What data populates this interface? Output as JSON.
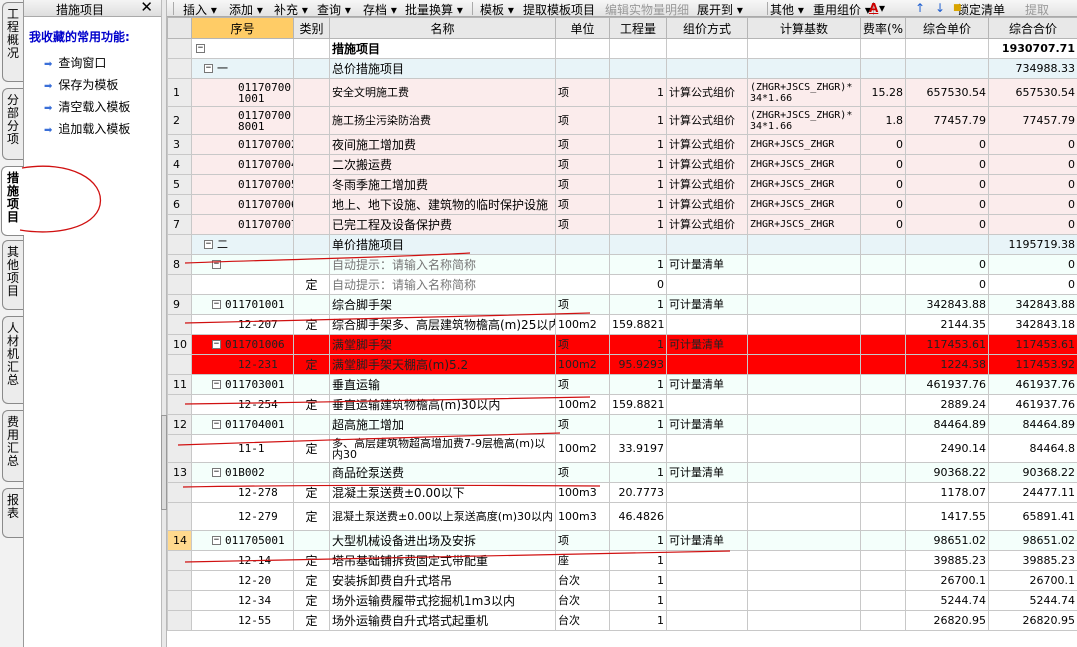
{
  "left_tabs": [
    {
      "label": "工程概况",
      "active": false
    },
    {
      "label": "分部分项",
      "active": false
    },
    {
      "label": "措施项目",
      "active": true
    },
    {
      "label": "其他项目",
      "active": false
    },
    {
      "label": "人材机汇总",
      "active": false
    },
    {
      "label": "费用汇总",
      "active": false
    },
    {
      "label": "报表",
      "active": false
    }
  ],
  "panel": {
    "title": "措施项目",
    "close_icon": "✕",
    "favorites_title": "我收藏的常用功能:",
    "items": [
      "查询窗口",
      "保存为模板",
      "清空载入模板",
      "追加载入模板"
    ]
  },
  "toolbar": {
    "items": [
      "插入 ▾",
      "添加 ▾",
      "补充 ▾",
      "查询 ▾",
      "存档 ▾",
      "批量换算 ▾",
      "模板 ▾",
      "提取模板项目",
      "编辑实物量明细",
      "展开到 ▾",
      "其他 ▾",
      "重用组价 ▾",
      "▾",
      "↑",
      "↓",
      "锁定清单",
      "提取"
    ]
  },
  "columns": [
    "序号",
    "类别",
    "名称",
    "单位",
    "工程量",
    "组价方式",
    "计算基数",
    "费率(%",
    "综合单价",
    "综合合价"
  ],
  "rows": [
    {
      "seq": "",
      "code": "",
      "cat": "",
      "name": "措施项目",
      "unit": "",
      "qty": "",
      "method": "",
      "base": "",
      "rate": "",
      "price": "",
      "total": "1930707.71",
      "style": "total",
      "tree": "−"
    },
    {
      "seq": "",
      "code": "一",
      "cat": "",
      "name": "总价措施项目",
      "unit": "",
      "qty": "",
      "method": "",
      "base": "",
      "rate": "",
      "price": "",
      "total": "734988.33",
      "style": "sec",
      "tree": "−"
    },
    {
      "seq": "1",
      "code": "011707001001",
      "cat": "",
      "name": "安全文明施工费",
      "unit": "项",
      "qty": "1",
      "method": "计算公式组价",
      "base": "(ZHGR+JSCS_ZHGR)*34*1.66",
      "rate": "15.28",
      "price": "657530.54",
      "total": "657530.54",
      "style": "pink",
      "tall": true
    },
    {
      "seq": "2",
      "code": "011707008001",
      "cat": "",
      "name": "施工扬尘污染防治费",
      "unit": "项",
      "qty": "1",
      "method": "计算公式组价",
      "base": "(ZHGR+JSCS_ZHGR)*34*1.66",
      "rate": "1.8",
      "price": "77457.79",
      "total": "77457.79",
      "style": "pink",
      "tall": true
    },
    {
      "seq": "3",
      "code": "011707002",
      "cat": "",
      "name": "夜间施工增加费",
      "unit": "项",
      "qty": "1",
      "method": "计算公式组价",
      "base": "ZHGR+JSCS_ZHGR",
      "rate": "0",
      "price": "0",
      "total": "0",
      "style": "pink"
    },
    {
      "seq": "4",
      "code": "011707004",
      "cat": "",
      "name": "二次搬运费",
      "unit": "项",
      "qty": "1",
      "method": "计算公式组价",
      "base": "ZHGR+JSCS_ZHGR",
      "rate": "0",
      "price": "0",
      "total": "0",
      "style": "pink"
    },
    {
      "seq": "5",
      "code": "011707005",
      "cat": "",
      "name": "冬雨季施工增加费",
      "unit": "项",
      "qty": "1",
      "method": "计算公式组价",
      "base": "ZHGR+JSCS_ZHGR",
      "rate": "0",
      "price": "0",
      "total": "0",
      "style": "pink"
    },
    {
      "seq": "6",
      "code": "011707006",
      "cat": "",
      "name": "地上、地下设施、建筑物的临时保护设施",
      "unit": "项",
      "qty": "1",
      "method": "计算公式组价",
      "base": "ZHGR+JSCS_ZHGR",
      "rate": "0",
      "price": "0",
      "total": "0",
      "style": "pink"
    },
    {
      "seq": "7",
      "code": "011707007",
      "cat": "",
      "name": "已完工程及设备保护费",
      "unit": "项",
      "qty": "1",
      "method": "计算公式组价",
      "base": "ZHGR+JSCS_ZHGR",
      "rate": "0",
      "price": "0",
      "total": "0",
      "style": "pink"
    },
    {
      "seq": "",
      "code": "二",
      "cat": "",
      "name": "单价措施项目",
      "unit": "",
      "qty": "",
      "method": "",
      "base": "",
      "rate": "",
      "price": "",
      "total": "1195719.38",
      "style": "sec",
      "tree": "−"
    },
    {
      "seq": "8",
      "code": "",
      "cat": "",
      "name": "自动提示：请输入名称简称",
      "unit": "",
      "qty": "1",
      "method": "可计量清单",
      "base": "",
      "rate": "",
      "price": "0",
      "total": "0",
      "style": "sub",
      "tree": "−",
      "grey": true
    },
    {
      "seq": "",
      "code": "",
      "cat": "定",
      "name": "自动提示：请输入名称简称",
      "unit": "",
      "qty": "0",
      "method": "",
      "base": "",
      "rate": "",
      "price": "0",
      "total": "0",
      "style": "white",
      "grey": true
    },
    {
      "seq": "9",
      "code": "011701001",
      "cat": "",
      "name": "综合脚手架",
      "unit": "项",
      "qty": "1",
      "method": "可计量清单",
      "base": "",
      "rate": "",
      "price": "342843.88",
      "total": "342843.88",
      "style": "sub",
      "tree": "−"
    },
    {
      "seq": "",
      "code": "12-207",
      "cat": "定",
      "name": "综合脚手架多、高层建筑物檐高(m)25以内",
      "unit": "100m2",
      "qty": "159.8821",
      "method": "",
      "base": "",
      "rate": "",
      "price": "2144.35",
      "total": "342843.18",
      "style": "white"
    },
    {
      "seq": "10",
      "code": "011701006",
      "cat": "",
      "name": "满堂脚手架",
      "unit": "项",
      "qty": "1",
      "method": "可计量清单",
      "base": "",
      "rate": "",
      "price": "117453.61",
      "total": "117453.61",
      "style": "red",
      "tree": "−"
    },
    {
      "seq": "",
      "code": "12-231",
      "cat": "定",
      "name": "满堂脚手架天棚高(m)5.2",
      "unit": "100m2",
      "qty": "95.9293",
      "method": "",
      "base": "",
      "rate": "",
      "price": "1224.38",
      "total": "117453.92",
      "style": "red"
    },
    {
      "seq": "11",
      "code": "011703001",
      "cat": "",
      "name": "垂直运输",
      "unit": "项",
      "qty": "1",
      "method": "可计量清单",
      "base": "",
      "rate": "",
      "price": "461937.76",
      "total": "461937.76",
      "style": "sub",
      "tree": "−"
    },
    {
      "seq": "",
      "code": "12-254",
      "cat": "定",
      "name": "垂直运输建筑物檐高(m)30以内",
      "unit": "100m2",
      "qty": "159.8821",
      "method": "",
      "base": "",
      "rate": "",
      "price": "2889.24",
      "total": "461937.76",
      "style": "white"
    },
    {
      "seq": "12",
      "code": "011704001",
      "cat": "",
      "name": "超高施工增加",
      "unit": "项",
      "qty": "1",
      "method": "可计量清单",
      "base": "",
      "rate": "",
      "price": "84464.89",
      "total": "84464.89",
      "style": "sub",
      "tree": "−"
    },
    {
      "seq": "",
      "code": "11-1",
      "cat": "定",
      "name": "多、高层建筑物超高增加费7-9层檐高(m)以内30",
      "unit": "100m2",
      "qty": "33.9197",
      "method": "",
      "base": "",
      "rate": "",
      "price": "2490.14",
      "total": "84464.8",
      "style": "white",
      "tall": true
    },
    {
      "seq": "13",
      "code": "01B002",
      "cat": "",
      "name": "商品砼泵送费",
      "unit": "项",
      "qty": "1",
      "method": "可计量清单",
      "base": "",
      "rate": "",
      "price": "90368.22",
      "total": "90368.22",
      "style": "sub",
      "tree": "−"
    },
    {
      "seq": "",
      "code": "12-278",
      "cat": "定",
      "name": "混凝土泵送费±0.00以下",
      "unit": "100m3",
      "qty": "20.7773",
      "method": "",
      "base": "",
      "rate": "",
      "price": "1178.07",
      "total": "24477.11",
      "style": "white"
    },
    {
      "seq": "",
      "code": "12-279",
      "cat": "定",
      "name": "混凝土泵送费±0.00以上泵送高度(m)30以内",
      "unit": "100m3",
      "qty": "46.4826",
      "method": "",
      "base": "",
      "rate": "",
      "price": "1417.55",
      "total": "65891.41",
      "style": "white",
      "tall": true
    },
    {
      "seq": "14",
      "code": "011705001",
      "cat": "",
      "name": "大型机械设备进出场及安拆",
      "unit": "项",
      "qty": "1",
      "method": "可计量清单",
      "base": "",
      "rate": "",
      "price": "98651.02",
      "total": "98651.02",
      "style": "sub",
      "tree": "−",
      "seqhl": true
    },
    {
      "seq": "",
      "code": "12-14",
      "cat": "定",
      "name": "塔吊基础铺拆费固定式带配重",
      "unit": "座",
      "qty": "1",
      "method": "",
      "base": "",
      "rate": "",
      "price": "39885.23",
      "total": "39885.23",
      "style": "white"
    },
    {
      "seq": "",
      "code": "12-20",
      "cat": "定",
      "name": "安装拆卸费自升式塔吊",
      "unit": "台次",
      "qty": "1",
      "method": "",
      "base": "",
      "rate": "",
      "price": "26700.1",
      "total": "26700.1",
      "style": "white"
    },
    {
      "seq": "",
      "code": "12-34",
      "cat": "定",
      "name": "场外运输费履带式挖掘机1m3以内",
      "unit": "台次",
      "qty": "1",
      "method": "",
      "base": "",
      "rate": "",
      "price": "5244.74",
      "total": "5244.74",
      "style": "white"
    },
    {
      "seq": "",
      "code": "12-55",
      "cat": "定",
      "name": "场外运输费自升式塔式起重机",
      "unit": "台次",
      "qty": "1",
      "method": "",
      "base": "",
      "rate": "",
      "price": "26820.95",
      "total": "26820.95",
      "style": "white"
    }
  ]
}
